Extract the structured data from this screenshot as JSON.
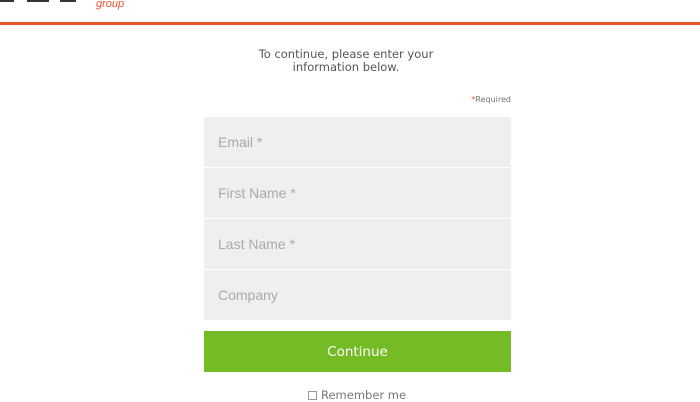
{
  "header": {
    "logo_text": "group",
    "accent_color": "#e8532a"
  },
  "intro": {
    "line1": "To continue, please enter your",
    "line2": "information below."
  },
  "required_note": {
    "star": "*",
    "label": "Required"
  },
  "form": {
    "email_placeholder": "Email *",
    "first_name_placeholder": "First Name *",
    "last_name_placeholder": "Last Name *",
    "company_placeholder": "Company"
  },
  "continue_button": {
    "label": "Continue",
    "color": "#74bb26"
  },
  "remember": {
    "label": "Remember me"
  }
}
